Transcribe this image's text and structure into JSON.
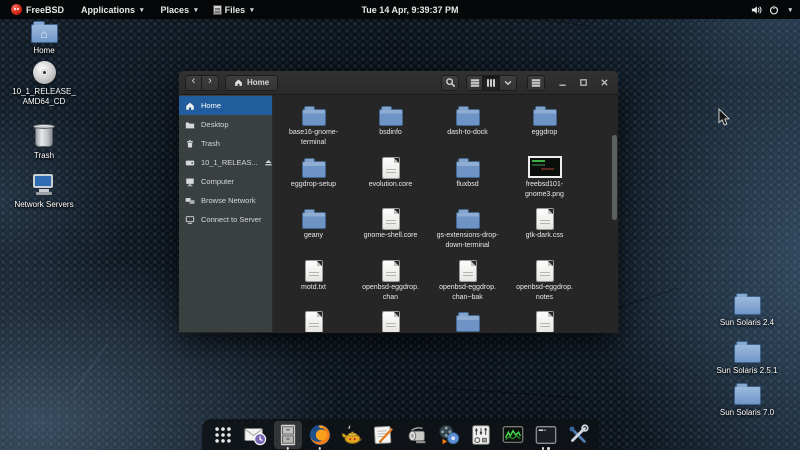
{
  "top_bar": {
    "menus": [
      {
        "label": "FreeBSD",
        "caret": false
      },
      {
        "label": "Applications",
        "caret": true
      },
      {
        "label": "Places",
        "caret": true
      },
      {
        "label": "Files",
        "caret": true,
        "icon": "files-app-icon"
      }
    ],
    "clock": "Tue 14 Apr, 9:39:37 PM",
    "status_icons": [
      "volume-icon",
      "power-icon",
      "chevron-down-icon"
    ]
  },
  "desktop": {
    "left_icons": [
      {
        "label": "Home",
        "type": "home-folder"
      },
      {
        "label": "10_1_RELEASE_\nAMD64_CD",
        "type": "optical-disc"
      },
      {
        "label": "Trash",
        "type": "trash"
      },
      {
        "label": "Network Servers",
        "type": "network"
      }
    ],
    "right_icons": [
      {
        "label": "Sun Solaris 2.4",
        "type": "folder"
      },
      {
        "label": "Sun Solaris 2.5.1",
        "type": "folder"
      },
      {
        "label": "Sun Solaris 7.0",
        "type": "folder"
      }
    ]
  },
  "window": {
    "nav": {
      "back_glyph": "‹",
      "forward_glyph": "›",
      "path_label": "Home",
      "path_icon": "home-icon"
    },
    "toolbar_icons": [
      "search-icon",
      "view-grid-icon",
      "view-list-icon",
      "view-options-chevron-icon",
      "menu-icon"
    ],
    "window_controls": [
      "minimize",
      "maximize",
      "close"
    ],
    "sidebar": {
      "items": [
        {
          "label": "Home",
          "icon": "home",
          "selected": true
        },
        {
          "label": "Desktop",
          "icon": "folder"
        },
        {
          "label": "Trash",
          "icon": "trash"
        },
        {
          "label": "10_1_RELEAS...",
          "icon": "disc",
          "eject": true
        },
        {
          "label": "Computer",
          "icon": "computer"
        },
        {
          "label": "Browse Network",
          "icon": "network"
        },
        {
          "label": "Connect to Server",
          "icon": "server"
        }
      ]
    },
    "files": [
      {
        "label": "base16-gnome-\nterminal",
        "type": "folder"
      },
      {
        "label": "bsdinfo",
        "type": "folder"
      },
      {
        "label": "dash-to-dock",
        "type": "folder"
      },
      {
        "label": "eggdrop",
        "type": "folder"
      },
      {
        "label": "eggdrop-setup",
        "type": "folder"
      },
      {
        "label": "evolution.core",
        "type": "file"
      },
      {
        "label": "fluxbsd",
        "type": "folder"
      },
      {
        "label": "freebsd101-\ngnome3.png",
        "type": "image"
      },
      {
        "label": "geany",
        "type": "folder"
      },
      {
        "label": "gnome-shell.core",
        "type": "file"
      },
      {
        "label": "gs-extensions-drop-\ndown-terminal",
        "type": "folder"
      },
      {
        "label": "gtk-dark.css",
        "type": "file"
      },
      {
        "label": "motd.txt",
        "type": "file"
      },
      {
        "label": "openbsd-eggdrop.\nchan",
        "type": "file"
      },
      {
        "label": "openbsd-eggdrop.\nchan~bak",
        "type": "file"
      },
      {
        "label": "openbsd-eggdrop.\nnotes",
        "type": "file"
      },
      {
        "label": "",
        "type": "file"
      },
      {
        "label": "",
        "type": "file"
      },
      {
        "label": "",
        "type": "folder"
      },
      {
        "label": "",
        "type": "file"
      }
    ]
  },
  "dock": {
    "items": [
      {
        "name": "show-applications",
        "running_dots": 0
      },
      {
        "name": "evolution-mail",
        "running_dots": 0
      },
      {
        "name": "files",
        "running_dots": 1,
        "active": true
      },
      {
        "name": "firefox",
        "running_dots": 1
      },
      {
        "name": "genie-lamp",
        "running_dots": 0
      },
      {
        "name": "text-editor",
        "running_dots": 0
      },
      {
        "name": "printer",
        "running_dots": 0
      },
      {
        "name": "media-player",
        "running_dots": 0
      },
      {
        "name": "control-center",
        "running_dots": 0
      },
      {
        "name": "system-monitor",
        "running_dots": 0
      },
      {
        "name": "terminal",
        "running_dots": 2
      },
      {
        "name": "tweak-tool",
        "running_dots": 0
      }
    ]
  },
  "colors": {
    "selection_blue": "#215d9c",
    "folder_blue": "#6f96c6",
    "topbar_bg": "#050708",
    "sidebar_bg": "#3a4040",
    "content_bg": "#262626"
  }
}
